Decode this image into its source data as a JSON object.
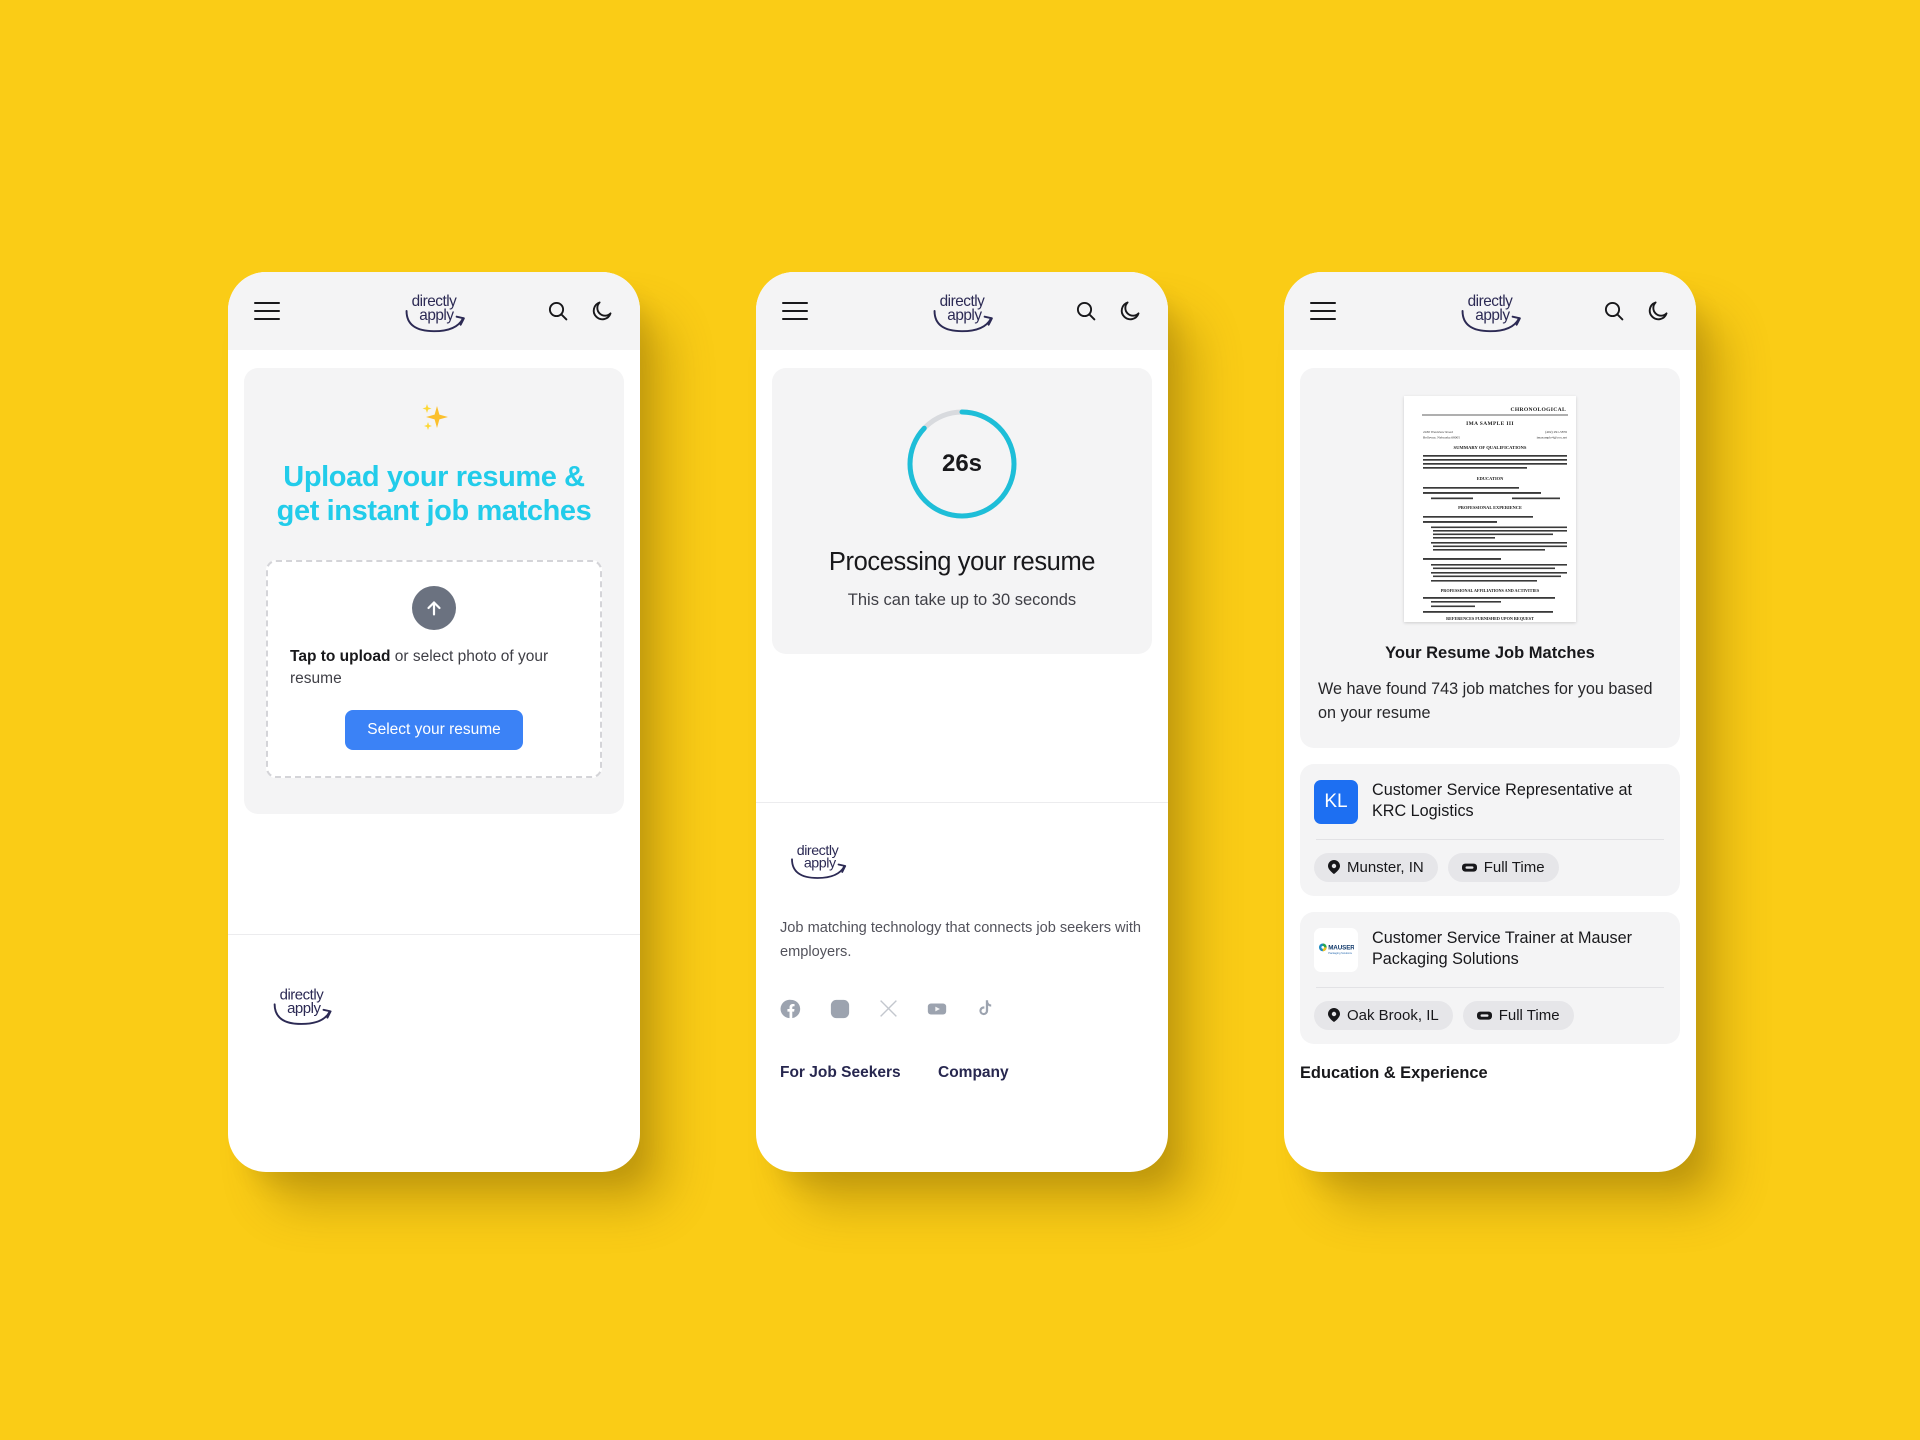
{
  "background_color": "#facc16",
  "brand": {
    "name": "directly apply",
    "logo_color": "#2c2a54",
    "accent_cyan": "#22ccea",
    "accent_blue": "#3b82f6"
  },
  "header": {
    "menu_icon": "hamburger-menu-icon",
    "logo_text": "directly apply",
    "search_icon": "search-icon",
    "theme_icon": "moon-icon"
  },
  "screen_upload": {
    "sparkle_icon": "sparkles-icon",
    "title": "Upload your resume & get instant job matches",
    "dropzone": {
      "upload_icon": "upload-arrow-circle-icon",
      "hint_bold": "Tap to upload",
      "hint_rest": " or select photo of your resume",
      "button_label": "Select your resume"
    },
    "footer_logo_text": "directly apply"
  },
  "screen_processing": {
    "timer_value": "26s",
    "progress_percent": 87,
    "progress_track_color": "#d8dade",
    "progress_color": "#1ebed8",
    "heading": "Processing your resume",
    "subheading": "This can take up to 30 seconds",
    "footer": {
      "logo_text": "directly apply",
      "tagline": "Job matching technology that connects job seekers with employers.",
      "socials": [
        {
          "name": "facebook-icon"
        },
        {
          "name": "instagram-icon"
        },
        {
          "name": "x-twitter-icon"
        },
        {
          "name": "youtube-icon"
        },
        {
          "name": "tiktok-icon"
        }
      ],
      "columns": [
        {
          "title": "For Job Seekers"
        },
        {
          "title": "Company"
        }
      ]
    }
  },
  "screen_matches": {
    "resume_preview": {
      "doc_type": "CHRONOLOGICAL",
      "name": "IMA SAMPLE III",
      "address_line1": "2430 Westview Road",
      "address_line2": "Bellevue, Nebraska 68005",
      "phone": "(402) 291-5876",
      "email": "imasample4@cox.net",
      "sections": [
        "SUMMARY OF QUALIFICATIONS",
        "EDUCATION",
        "PROFESSIONAL EXPERIENCE",
        "PROFESSIONAL AFFILIATIONS AND ACTIVITIES",
        "REFERENCES FURNISHED UPON REQUEST"
      ]
    },
    "match_title": "Your Resume Job Matches",
    "match_sub": "We have found 743 job matches for you based on your resume",
    "match_count": 743,
    "jobs": [
      {
        "logo_type": "initials",
        "logo_initials": "KL",
        "logo_color": "#1d6ff2",
        "title": "Customer Service Representative at KRC Logistics",
        "location": "Munster, IN",
        "location_icon": "map-pin-icon",
        "job_type": "Full Time",
        "job_type_icon": "briefcase-icon"
      },
      {
        "logo_type": "image",
        "logo_label": "MAUSER",
        "logo_sublabel": "Packaging Solutions",
        "title": "Customer Service Trainer at Mauser Packaging Solutions",
        "location": "Oak Brook, IL",
        "location_icon": "map-pin-icon",
        "job_type": "Full Time",
        "job_type_icon": "briefcase-icon"
      }
    ],
    "next_section_title": "Education & Experience"
  }
}
